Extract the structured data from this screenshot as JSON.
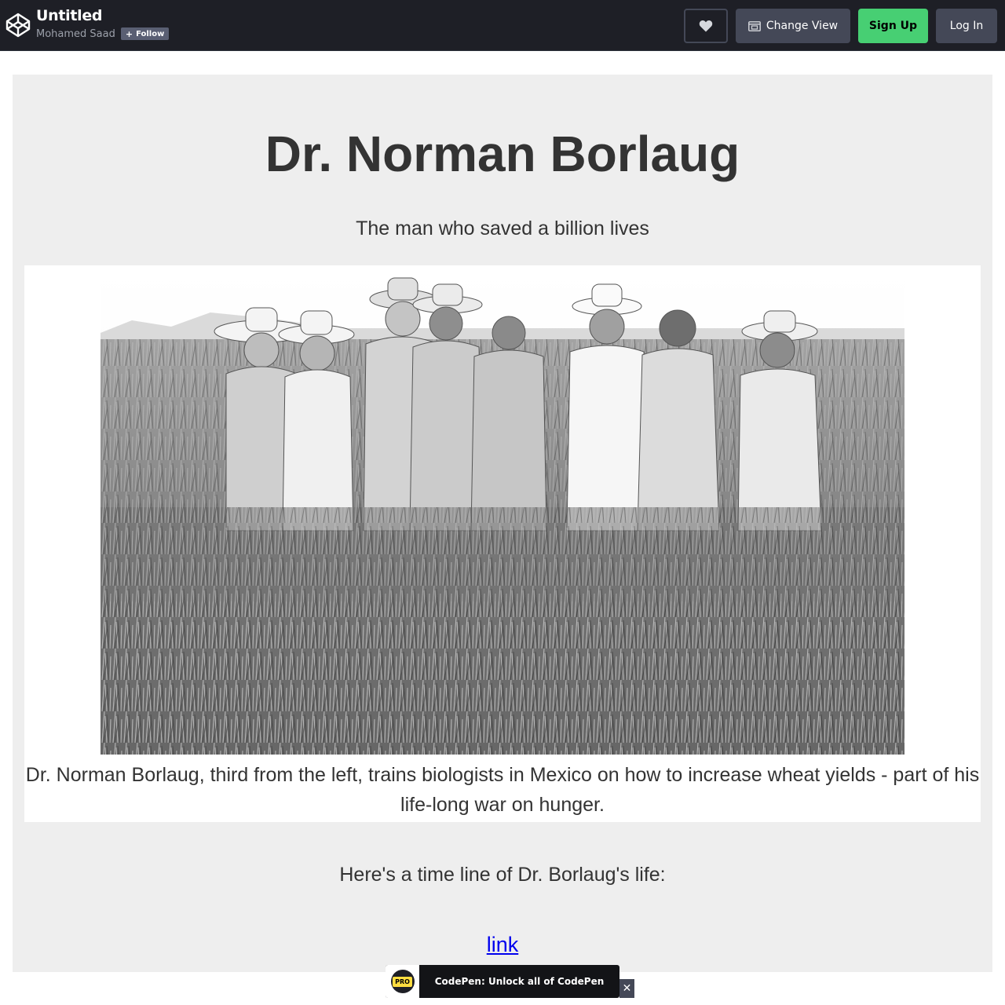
{
  "header": {
    "pen_title": "Untitled",
    "author": "Mohamed Saad",
    "follow_plus": "+",
    "follow_label": "Follow",
    "heart_icon": "heart-icon",
    "change_view_label": "Change View",
    "change_view_icon": "window-icon",
    "signup_label": "Sign Up",
    "login_label": "Log In",
    "colors": {
      "bar": "#1e1f26",
      "signup": "#47cf73",
      "button": "#444857"
    }
  },
  "content": {
    "title": "Dr. Norman Borlaug",
    "subtitle": "The man who saved a billion lives",
    "image_caption": "Dr. Norman Borlaug, third from the left, trains biologists in Mexico on how to increase wheat yields - part of his life-long war on hunger.",
    "timeline_intro": "Here's a time line of Dr. Borlaug's life:",
    "link_text": "link"
  },
  "promo": {
    "badge": "PRO",
    "text": "CodePen: Unlock all of CodePen",
    "close": "✕"
  }
}
